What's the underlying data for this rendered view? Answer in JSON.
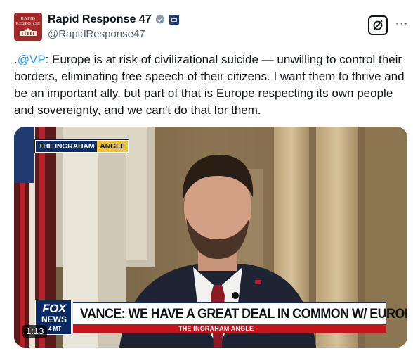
{
  "header": {
    "avatar_text": "RAPID RESPONSE",
    "display_name": "Rapid Response 47",
    "handle": "@RapidResponse47",
    "verified_icon": "verified-badge-icon",
    "affiliation_icon": "government-building-icon",
    "grok_icon": "grok-icon",
    "more_icon": "more-icon",
    "more_label": "···"
  },
  "tweet": {
    "prefix": ".",
    "mention": "@VP",
    "body": ": Europe is at risk of civilizational suicide — unwilling to control their borders, eliminating free speech of their citizens. I want them to thrive and be an important ally, but part of that is Europe respecting its own people and sovereignty, and we can't do that for them."
  },
  "video": {
    "show_tag_part1": "THE INGRAHAM",
    "show_tag_part2": "ANGLE",
    "network_top": "FOX",
    "network_bottom": "NEWS",
    "network_suffix": "4 MT",
    "headline": "VANCE: WE HAVE A GREAT DEAL IN COMMON W/ EUROPE",
    "sub_banner": "THE INGRAHAM ANGLE",
    "duration": "1:13"
  },
  "colors": {
    "link": "#1d9bf0",
    "verified": "#829aab",
    "fox_blue": "#0a2a66",
    "banner_red": "#c4161c",
    "show_yellow": "#f3c32d"
  }
}
